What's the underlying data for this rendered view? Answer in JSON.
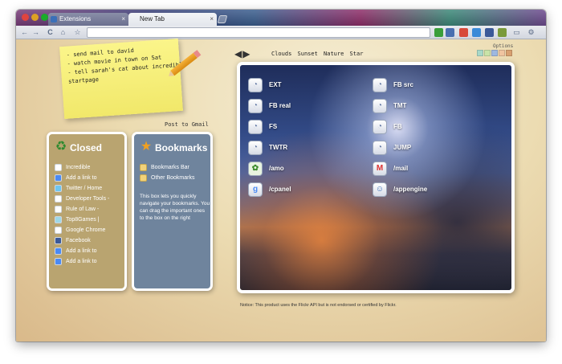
{
  "browser": {
    "tabs": [
      {
        "label": "Extensions",
        "close": "×"
      },
      {
        "label": "New Tab",
        "close": "×"
      }
    ],
    "nav": {
      "back": "←",
      "forward": "→",
      "reload": "C",
      "home": "⌂",
      "star": "☆"
    },
    "omnibox_value": ""
  },
  "note": {
    "lines": [
      "- send mail to david",
      "- watch movie in town on Sat",
      "- tell sarah's cat about incredible",
      "startpage"
    ],
    "post_label": "Post to Gmail"
  },
  "closed_panel": {
    "title": "Closed",
    "icon": "recycle-icon",
    "items": [
      {
        "label": "Incredible"
      },
      {
        "label": "Add a link to"
      },
      {
        "label": "Twitter / Home"
      },
      {
        "label": "Developer Tools -"
      },
      {
        "label": "Rule of Law -"
      },
      {
        "label": "Top8Games |"
      },
      {
        "label": "Google Chrome"
      },
      {
        "label": "Facebook"
      },
      {
        "label": "Add a link to"
      },
      {
        "label": "Add a link to"
      }
    ]
  },
  "bookmarks_panel": {
    "title": "Bookmarks",
    "icon": "star-icon",
    "items": [
      {
        "label": "Bookmarks Bar"
      },
      {
        "label": "Other Bookmarks"
      }
    ],
    "description": "This box lets you quickly navigate your bookmarks. You can drag the important ones to the box on the right"
  },
  "themes": {
    "arrows": "🡄🡆",
    "names": [
      "Clouds",
      "Sunset",
      "Nature",
      "Star"
    ],
    "options_label": "Options",
    "swatches": [
      "#a8d8c8",
      "#c9e3a8",
      "#9fb8e0",
      "#f0c4a0",
      "#d8a070"
    ]
  },
  "speed_dial": [
    {
      "label": "EXT",
      "icon": "site-icon"
    },
    {
      "label": "FB src",
      "icon": "site-icon"
    },
    {
      "label": "FB real",
      "icon": "site-icon"
    },
    {
      "label": "TMT",
      "icon": "site-icon"
    },
    {
      "label": "FS",
      "icon": "site-icon"
    },
    {
      "label": "FB",
      "icon": "site-icon"
    },
    {
      "label": "TWTR",
      "icon": "site-icon"
    },
    {
      "label": "JUMP",
      "icon": "site-icon"
    },
    {
      "label": "/amo",
      "icon": "puzzle-icon"
    },
    {
      "label": "/mail",
      "icon": "gmail-icon"
    },
    {
      "label": "/cpanel",
      "icon": "google-icon"
    },
    {
      "label": "/appengine",
      "icon": "users-icon"
    }
  ],
  "notice": "Notice: This product uses the Flickr API but is not endorsed or certified by Flickr."
}
